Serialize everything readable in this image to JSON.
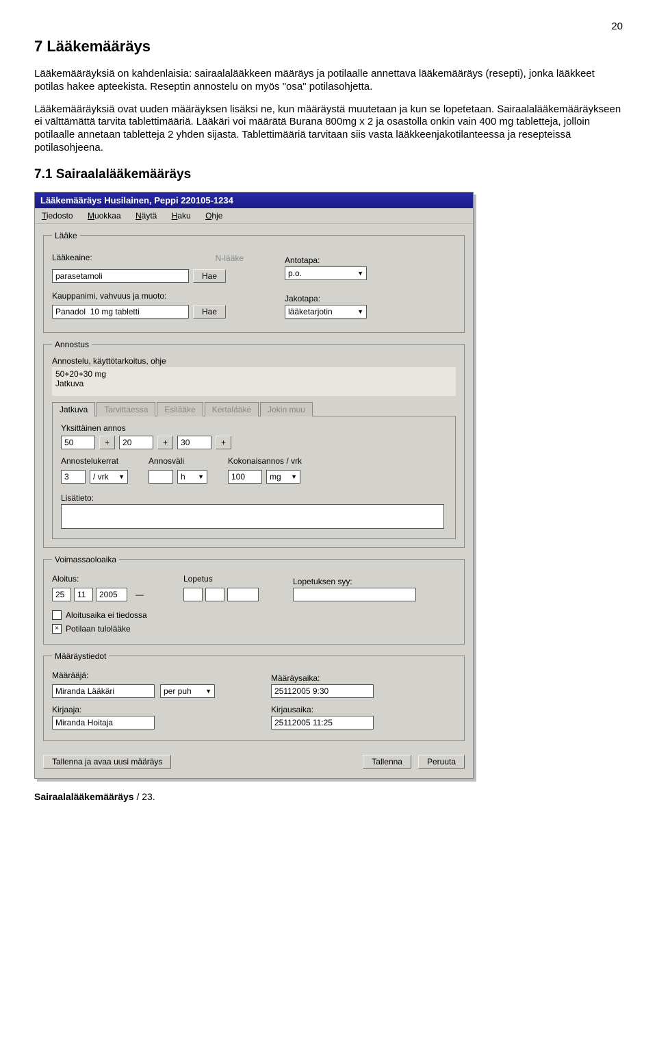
{
  "page_number": "20",
  "heading": "7  Lääkemääräys",
  "paragraphs": [
    "Lääkemääräyksiä on kahdenlaisia: sairaalalääkkeen määräys ja potilaalle annettava lääkemääräys (resepti), jonka lääkkeet potilas hakee apteekista. Reseptin annostelu on myös \"osa\" potilasohjetta.",
    "Lääkemääräyksiä ovat uuden määräyksen lisäksi ne, kun määräystä muutetaan ja kun se lopetetaan. Sairaalalääkemääräykseen ei välttämättä tarvita tablettimääriä. Lääkäri voi määrätä Burana 800mg x 2  ja osastolla onkin vain 400 mg tabletteja, jolloin  potilaalle annetaan tabletteja 2 yhden sijasta. Tablettimääriä tarvitaan siis vasta lääkkeenjakotilanteessa ja resepteissä potilasohjeena."
  ],
  "subheading": "7.1  Sairaalalääkemääräys",
  "app": {
    "title_prefix": "Lääkemääräys Husilainen, Peppi ",
    "title_bold": "220105-1234",
    "menu": {
      "tiedosto": "Tiedosto",
      "muokkaa": "Muokkaa",
      "nayta": "Näytä",
      "haku": "Haku",
      "ohje": "Ohje"
    },
    "laake": {
      "legend": "Lääke",
      "laakeaine_label": "Lääkeaine:",
      "nlaake": "N-lääke",
      "laakeaine_value": "parasetamoli",
      "hae": "Hae",
      "antotapa_label": "Antotapa:",
      "antotapa_value": "p.o.",
      "kauppanimi_label": "Kauppanimi, vahvuus ja muoto:",
      "kauppanimi_value": "Panadol  10 mg tabletti",
      "jakotapa_label": "Jakotapa:",
      "jakotapa_value": "lääketarjotin"
    },
    "annostus": {
      "legend": "Annostus",
      "ohje_label": "Annostelu, käyttötarkoitus, ohje",
      "ohje_line1": "50+20+30 mg",
      "ohje_line2": "Jatkuva",
      "tabs": {
        "jatkuva": "Jatkuva",
        "tarvittaessa": "Tarvittaessa",
        "esilaake": "Esilääke",
        "kertalaake": "Kertalääke",
        "jokinmuu": "Jokin muu"
      },
      "yksittainen_label": "Yksittäinen annos",
      "annos": [
        "50",
        "20",
        "30",
        ""
      ],
      "plus": "+",
      "annostelukerrat_label": "Annostelukerrat",
      "annostelukerrat_value": "3",
      "vrk_unit": "/ vrk",
      "annosvali_label": "Annosväli",
      "annosvali_value": "",
      "h_unit": "h",
      "kokonais_label": "Kokonaisannos / vrk",
      "kokonais_value": "100",
      "kokonais_unit": "mg",
      "lisatieto_label": "Lisätieto:",
      "lisatieto_value": ""
    },
    "voimassa": {
      "legend": "Voimassaoloaika",
      "aloitus_label": "Aloitus:",
      "aloitus_d": "25",
      "aloitus_m": "11",
      "aloitus_y": "2005",
      "lopetus_label": "Lopetus",
      "lopetussyy_label": "Lopetuksen syy:",
      "dash": "—",
      "chk1": "Aloitusaika ei tiedossa",
      "chk2": "Potilaan tulolääke"
    },
    "maarays": {
      "legend": "Määräystiedot",
      "maaraaja_label": "Määrääjä:",
      "maaraaja_value": "Miranda Lääkäri",
      "perpuh": "per puh",
      "maaraysaika_label": "Määräysaika:",
      "maaraysaika_value": "25112005 9:30",
      "kirjaaja_label": "Kirjaaja:",
      "kirjaaja_value": "Miranda Hoitaja",
      "kirjausaika_label": "Kirjausaika:",
      "kirjausaika_value": "25112005 11:25"
    },
    "buttons": {
      "tallenna_uusi": "Tallenna ja avaa uusi määräys",
      "tallenna": "Tallenna",
      "peruuta": "Peruuta"
    }
  },
  "footer_bold": "Sairaalalääkemääräys",
  "footer_rest": " / 23."
}
